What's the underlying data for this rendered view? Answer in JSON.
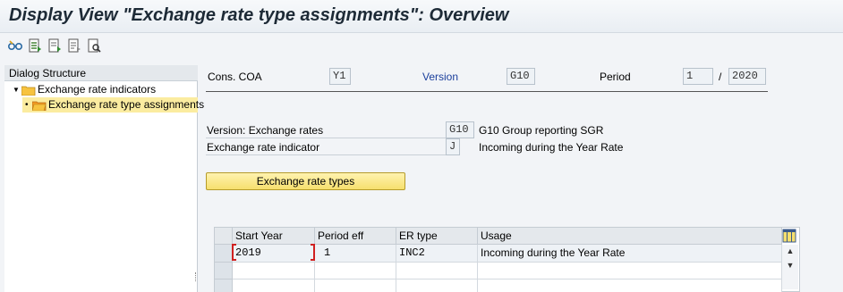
{
  "window": {
    "title": "Display View \"Exchange rate type assignments\": Overview"
  },
  "toolbar": {
    "buttons": [
      {
        "icon": "glasses-toggle-icon"
      },
      {
        "icon": "select-all-icon"
      },
      {
        "icon": "export-icon"
      },
      {
        "icon": "print-icon"
      },
      {
        "icon": "find-icon"
      }
    ]
  },
  "dialog_structure": {
    "header": "Dialog Structure",
    "items": [
      {
        "label": "Exchange rate indicators",
        "expanded": true,
        "selected": false
      },
      {
        "label": "Exchange rate type assignments",
        "expanded": false,
        "selected": true
      }
    ]
  },
  "header_fields": {
    "cons_coa_label": "Cons. COA",
    "cons_coa_value": "Y1",
    "version_label": "Version",
    "version_value": "G10",
    "period_label": "Period",
    "period_value": "1",
    "period_separator": "/",
    "year_value": "2020"
  },
  "detail_fields": {
    "version_rates_label": "Version: Exchange rates",
    "version_rates_value": "G10",
    "version_rates_desc": "G10 Group reporting SGR",
    "er_indicator_label": "Exchange rate indicator",
    "er_indicator_value": "J",
    "er_indicator_desc": "Incoming during the Year Rate"
  },
  "buttons": {
    "exchange_rate_types": "Exchange rate types"
  },
  "table": {
    "columns": [
      "Start Year",
      "Period eff",
      "ER type",
      "Usage"
    ],
    "rows": [
      {
        "start_year": "2019",
        "period_eff": "1",
        "er_type": "INC2",
        "usage": "Incoming during the Year Rate"
      }
    ]
  },
  "colors": {
    "selected_row": "#fbeca0",
    "button_yellow": "#f6df6d",
    "focus_red": "#d02020",
    "version_blue": "#1b3f9c"
  }
}
